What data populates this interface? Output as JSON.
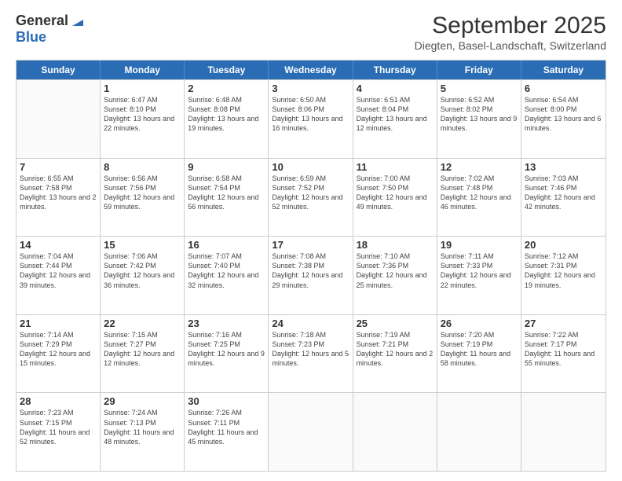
{
  "logo": {
    "general": "General",
    "blue": "Blue"
  },
  "header": {
    "month": "September 2025",
    "location": "Diegten, Basel-Landschaft, Switzerland"
  },
  "weekdays": [
    "Sunday",
    "Monday",
    "Tuesday",
    "Wednesday",
    "Thursday",
    "Friday",
    "Saturday"
  ],
  "weeks": [
    [
      {
        "day": "",
        "sunrise": "",
        "sunset": "",
        "daylight": ""
      },
      {
        "day": "1",
        "sunrise": "Sunrise: 6:47 AM",
        "sunset": "Sunset: 8:10 PM",
        "daylight": "Daylight: 13 hours and 22 minutes."
      },
      {
        "day": "2",
        "sunrise": "Sunrise: 6:48 AM",
        "sunset": "Sunset: 8:08 PM",
        "daylight": "Daylight: 13 hours and 19 minutes."
      },
      {
        "day": "3",
        "sunrise": "Sunrise: 6:50 AM",
        "sunset": "Sunset: 8:06 PM",
        "daylight": "Daylight: 13 hours and 16 minutes."
      },
      {
        "day": "4",
        "sunrise": "Sunrise: 6:51 AM",
        "sunset": "Sunset: 8:04 PM",
        "daylight": "Daylight: 13 hours and 12 minutes."
      },
      {
        "day": "5",
        "sunrise": "Sunrise: 6:52 AM",
        "sunset": "Sunset: 8:02 PM",
        "daylight": "Daylight: 13 hours and 9 minutes."
      },
      {
        "day": "6",
        "sunrise": "Sunrise: 6:54 AM",
        "sunset": "Sunset: 8:00 PM",
        "daylight": "Daylight: 13 hours and 6 minutes."
      }
    ],
    [
      {
        "day": "7",
        "sunrise": "Sunrise: 6:55 AM",
        "sunset": "Sunset: 7:58 PM",
        "daylight": "Daylight: 13 hours and 2 minutes."
      },
      {
        "day": "8",
        "sunrise": "Sunrise: 6:56 AM",
        "sunset": "Sunset: 7:56 PM",
        "daylight": "Daylight: 12 hours and 59 minutes."
      },
      {
        "day": "9",
        "sunrise": "Sunrise: 6:58 AM",
        "sunset": "Sunset: 7:54 PM",
        "daylight": "Daylight: 12 hours and 56 minutes."
      },
      {
        "day": "10",
        "sunrise": "Sunrise: 6:59 AM",
        "sunset": "Sunset: 7:52 PM",
        "daylight": "Daylight: 12 hours and 52 minutes."
      },
      {
        "day": "11",
        "sunrise": "Sunrise: 7:00 AM",
        "sunset": "Sunset: 7:50 PM",
        "daylight": "Daylight: 12 hours and 49 minutes."
      },
      {
        "day": "12",
        "sunrise": "Sunrise: 7:02 AM",
        "sunset": "Sunset: 7:48 PM",
        "daylight": "Daylight: 12 hours and 46 minutes."
      },
      {
        "day": "13",
        "sunrise": "Sunrise: 7:03 AM",
        "sunset": "Sunset: 7:46 PM",
        "daylight": "Daylight: 12 hours and 42 minutes."
      }
    ],
    [
      {
        "day": "14",
        "sunrise": "Sunrise: 7:04 AM",
        "sunset": "Sunset: 7:44 PM",
        "daylight": "Daylight: 12 hours and 39 minutes."
      },
      {
        "day": "15",
        "sunrise": "Sunrise: 7:06 AM",
        "sunset": "Sunset: 7:42 PM",
        "daylight": "Daylight: 12 hours and 36 minutes."
      },
      {
        "day": "16",
        "sunrise": "Sunrise: 7:07 AM",
        "sunset": "Sunset: 7:40 PM",
        "daylight": "Daylight: 12 hours and 32 minutes."
      },
      {
        "day": "17",
        "sunrise": "Sunrise: 7:08 AM",
        "sunset": "Sunset: 7:38 PM",
        "daylight": "Daylight: 12 hours and 29 minutes."
      },
      {
        "day": "18",
        "sunrise": "Sunrise: 7:10 AM",
        "sunset": "Sunset: 7:36 PM",
        "daylight": "Daylight: 12 hours and 25 minutes."
      },
      {
        "day": "19",
        "sunrise": "Sunrise: 7:11 AM",
        "sunset": "Sunset: 7:33 PM",
        "daylight": "Daylight: 12 hours and 22 minutes."
      },
      {
        "day": "20",
        "sunrise": "Sunrise: 7:12 AM",
        "sunset": "Sunset: 7:31 PM",
        "daylight": "Daylight: 12 hours and 19 minutes."
      }
    ],
    [
      {
        "day": "21",
        "sunrise": "Sunrise: 7:14 AM",
        "sunset": "Sunset: 7:29 PM",
        "daylight": "Daylight: 12 hours and 15 minutes."
      },
      {
        "day": "22",
        "sunrise": "Sunrise: 7:15 AM",
        "sunset": "Sunset: 7:27 PM",
        "daylight": "Daylight: 12 hours and 12 minutes."
      },
      {
        "day": "23",
        "sunrise": "Sunrise: 7:16 AM",
        "sunset": "Sunset: 7:25 PM",
        "daylight": "Daylight: 12 hours and 9 minutes."
      },
      {
        "day": "24",
        "sunrise": "Sunrise: 7:18 AM",
        "sunset": "Sunset: 7:23 PM",
        "daylight": "Daylight: 12 hours and 5 minutes."
      },
      {
        "day": "25",
        "sunrise": "Sunrise: 7:19 AM",
        "sunset": "Sunset: 7:21 PM",
        "daylight": "Daylight: 12 hours and 2 minutes."
      },
      {
        "day": "26",
        "sunrise": "Sunrise: 7:20 AM",
        "sunset": "Sunset: 7:19 PM",
        "daylight": "Daylight: 11 hours and 58 minutes."
      },
      {
        "day": "27",
        "sunrise": "Sunrise: 7:22 AM",
        "sunset": "Sunset: 7:17 PM",
        "daylight": "Daylight: 11 hours and 55 minutes."
      }
    ],
    [
      {
        "day": "28",
        "sunrise": "Sunrise: 7:23 AM",
        "sunset": "Sunset: 7:15 PM",
        "daylight": "Daylight: 11 hours and 52 minutes."
      },
      {
        "day": "29",
        "sunrise": "Sunrise: 7:24 AM",
        "sunset": "Sunset: 7:13 PM",
        "daylight": "Daylight: 11 hours and 48 minutes."
      },
      {
        "day": "30",
        "sunrise": "Sunrise: 7:26 AM",
        "sunset": "Sunset: 7:11 PM",
        "daylight": "Daylight: 11 hours and 45 minutes."
      },
      {
        "day": "",
        "sunrise": "",
        "sunset": "",
        "daylight": ""
      },
      {
        "day": "",
        "sunrise": "",
        "sunset": "",
        "daylight": ""
      },
      {
        "day": "",
        "sunrise": "",
        "sunset": "",
        "daylight": ""
      },
      {
        "day": "",
        "sunrise": "",
        "sunset": "",
        "daylight": ""
      }
    ]
  ]
}
